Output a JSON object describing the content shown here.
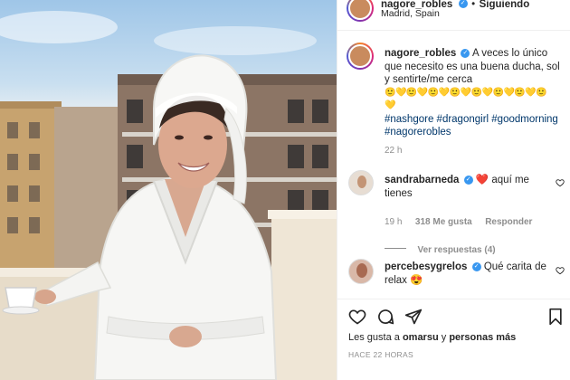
{
  "header": {
    "username": "nagore_robles",
    "follow_sep": "•",
    "follow_label": "Siguiendo",
    "location": "Madrid, Spain"
  },
  "caption": {
    "username": "nagore_robles",
    "text": "A veces lo único que necesito es una buena ducha, sol y sentirte/me cerca",
    "emoji_line": "🙂💛🙂💛🙂💛🙂💛🙂💛🙂💛🙂💛🙂",
    "emoji_line2": "💛",
    "hashtags": "#nashgore #dragongirl #goodmorning #nagorerobles",
    "time": "22 h"
  },
  "comments": [
    {
      "username": "sandrabarneda",
      "text": "aquí me tienes",
      "time": "19 h",
      "likes": "318 Me gusta",
      "reply": "Responder",
      "view_replies": "Ver respuestas (4)"
    },
    {
      "username": "percebesygrelos",
      "text": "Qué carita de relax 😍"
    }
  ],
  "actions": {
    "likes_prefix": "Les gusta a",
    "likes_user": "omarsu",
    "likes_connector": "y",
    "likes_more": "personas más",
    "posted_ago": "HACE 22 HORAS"
  },
  "icons": {
    "like": "heart-icon",
    "comment": "comment-icon",
    "share": "paper-plane-icon",
    "save": "bookmark-icon",
    "verified": "verified-badge-icon",
    "comment_like": "heart-outline-icon"
  },
  "colors": {
    "verified": "#3897f0",
    "link": "#00376b",
    "gray": "#8e8e8e",
    "border": "#efefef"
  }
}
